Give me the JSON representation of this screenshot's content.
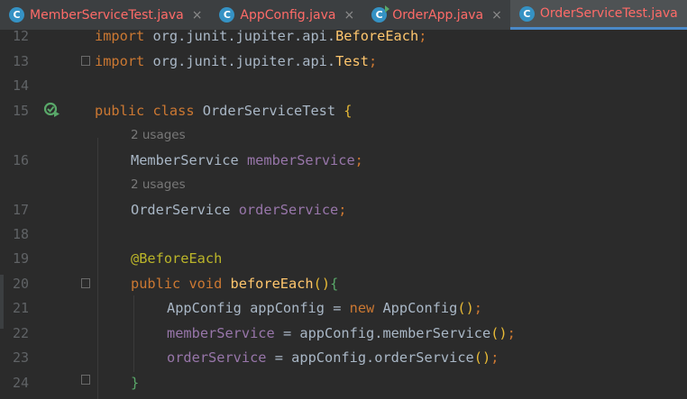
{
  "tabs": [
    {
      "label": "MemberServiceTest.java",
      "icon": "class-icon",
      "active": false,
      "run": false
    },
    {
      "label": "AppConfig.java",
      "icon": "class-icon",
      "active": false,
      "run": false
    },
    {
      "label": "OrderApp.java",
      "icon": "class-run-icon",
      "active": false,
      "run": true
    },
    {
      "label": "OrderServiceTest.java",
      "icon": "class-icon",
      "active": true,
      "run": false
    }
  ],
  "tab_close_glyph": "×",
  "gutter": {
    "line_numbers": [
      "12",
      "13",
      "14",
      "15",
      "16",
      "17",
      "18",
      "19",
      "20",
      "21",
      "22",
      "23",
      "24"
    ]
  },
  "hints": {
    "member_usages": "2 usages",
    "order_usages": "2 usages"
  },
  "code": {
    "l12": {
      "kw": "import",
      "pkg": " org.junit.jupiter.api.",
      "cls": "BeforeEach",
      "end": ";"
    },
    "l13": {
      "kw": "import",
      "pkg": " org.junit.jupiter.api.",
      "cls": "Test",
      "end": ";"
    },
    "l15": {
      "kw1": "public",
      "kw2": " class",
      "name": " OrderServiceTest",
      "brace": " {"
    },
    "l16": {
      "type": "MemberService",
      "field": " memberService",
      "end": ";"
    },
    "l17": {
      "type": "OrderService",
      "field": " orderService",
      "end": ";"
    },
    "l19": {
      "ann": "@BeforeEach"
    },
    "l20": {
      "kw1": "public",
      "kw2": " void",
      "method": " beforeEach",
      "paren": "()",
      "brace": "{"
    },
    "l21": {
      "type": "AppConfig appConfig = ",
      "kw": "new",
      "call": " AppConfig",
      "paren": "()",
      "end": ";"
    },
    "l22": {
      "field": "memberService",
      "rest": " = appConfig.memberService",
      "paren": "()",
      "end": ";"
    },
    "l23": {
      "field": "orderService",
      "rest": " = appConfig.orderService",
      "paren": "()",
      "end": ";"
    },
    "l24": {
      "brace": "}"
    }
  },
  "colors": {
    "background": "#2b2b2b",
    "keyword": "#cc7832",
    "field": "#9876aa",
    "method": "#ffc66d",
    "annotation": "#bbb529",
    "tab_text": "#ff6b68"
  }
}
